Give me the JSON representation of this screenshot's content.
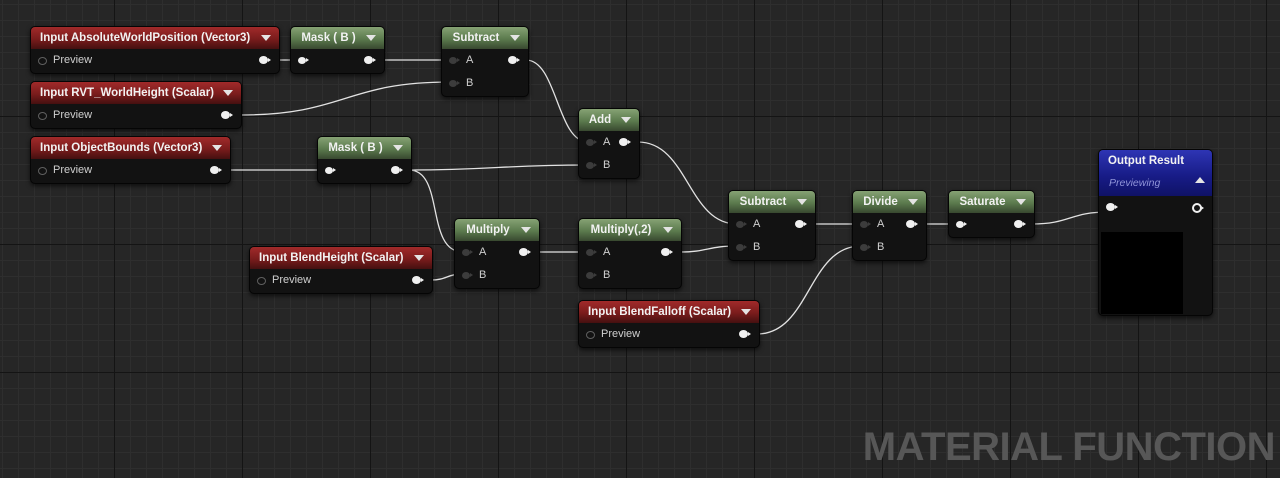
{
  "graph_type_label": "MATERIAL FUNCTION",
  "nodes": {
    "input_abs_world_pos": {
      "title": "Input AbsoluteWorldPosition (Vector3)",
      "preview": "Preview"
    },
    "input_rvt_world_height": {
      "title": "Input RVT_WorldHeight (Scalar)",
      "preview": "Preview"
    },
    "input_object_bounds": {
      "title": "Input ObjectBounds (Vector3)",
      "preview": "Preview"
    },
    "input_blend_height": {
      "title": "Input BlendHeight (Scalar)",
      "preview": "Preview"
    },
    "input_blend_falloff": {
      "title": "Input BlendFalloff (Scalar)",
      "preview": "Preview"
    },
    "mask_1": {
      "title": "Mask ( B )"
    },
    "mask_2": {
      "title": "Mask ( B )"
    },
    "subtract_1": {
      "title": "Subtract",
      "pin_a": "A",
      "pin_b": "B"
    },
    "add": {
      "title": "Add",
      "pin_a": "A",
      "pin_b": "B"
    },
    "multiply": {
      "title": "Multiply",
      "pin_a": "A",
      "pin_b": "B"
    },
    "multiply_2": {
      "title": "Multiply(,2)",
      "pin_a": "A",
      "pin_b": "B"
    },
    "subtract_2": {
      "title": "Subtract",
      "pin_a": "A",
      "pin_b": "B"
    },
    "divide": {
      "title": "Divide",
      "pin_a": "A",
      "pin_b": "B"
    },
    "saturate": {
      "title": "Saturate"
    },
    "output_result": {
      "title": "Output Result",
      "subtitle": "Previewing"
    }
  },
  "colors": {
    "input_header": "#8e2222",
    "math_header": "#5b7a4d",
    "output_header": "#181c88",
    "wire": "#e8e8e8",
    "background": "#262626"
  }
}
